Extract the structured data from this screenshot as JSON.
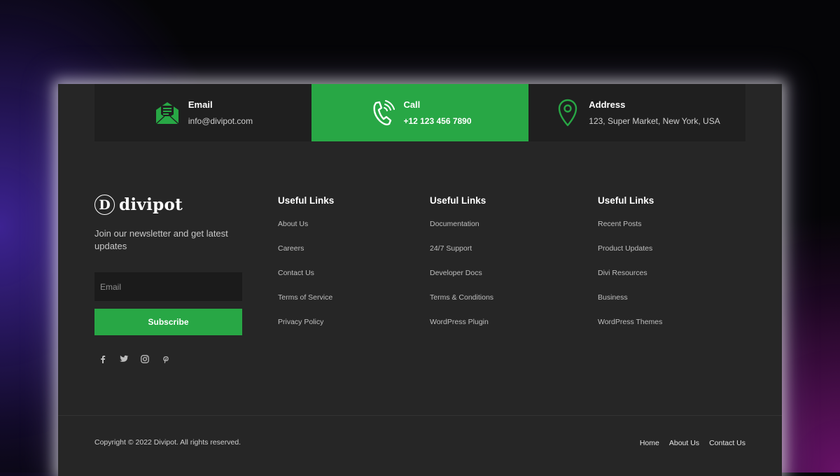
{
  "contact": [
    {
      "title": "Email",
      "value": "info@divipot.com",
      "icon": "envelope-icon"
    },
    {
      "title": "Call",
      "value": "+12 123 456 7890",
      "icon": "phone-icon"
    },
    {
      "title": "Address",
      "value": "123, Super Market, New York, USA",
      "icon": "map-pin-icon"
    }
  ],
  "brand": {
    "mark": "D",
    "name": "divipot"
  },
  "newsletter": {
    "tagline": "Join our newsletter and get latest updates",
    "placeholder": "Email",
    "button": "Subscribe"
  },
  "socials": [
    "facebook-icon",
    "twitter-icon",
    "instagram-icon",
    "pinterest-icon"
  ],
  "columns": [
    {
      "title": "Useful Links",
      "links": [
        "About Us",
        "Careers",
        "Contact Us",
        "Terms of Service",
        "Privacy Policy"
      ]
    },
    {
      "title": "Useful Links",
      "links": [
        "Documentation",
        "24/7 Support",
        "Developer Docs",
        "Terms & Conditions",
        "WordPress Plugin"
      ]
    },
    {
      "title": "Useful Links",
      "links": [
        "Recent Posts",
        "Product Updates",
        "Divi Resources",
        "Business",
        "WordPress Themes"
      ]
    }
  ],
  "footer": {
    "copyright": "Copyright © 2022 Divipot. All rights reserved.",
    "nav": [
      "Home",
      "About Us",
      "Contact Us"
    ]
  },
  "colors": {
    "accent": "#28a745",
    "panel": "#262626",
    "cell": "#1f1f1f"
  }
}
